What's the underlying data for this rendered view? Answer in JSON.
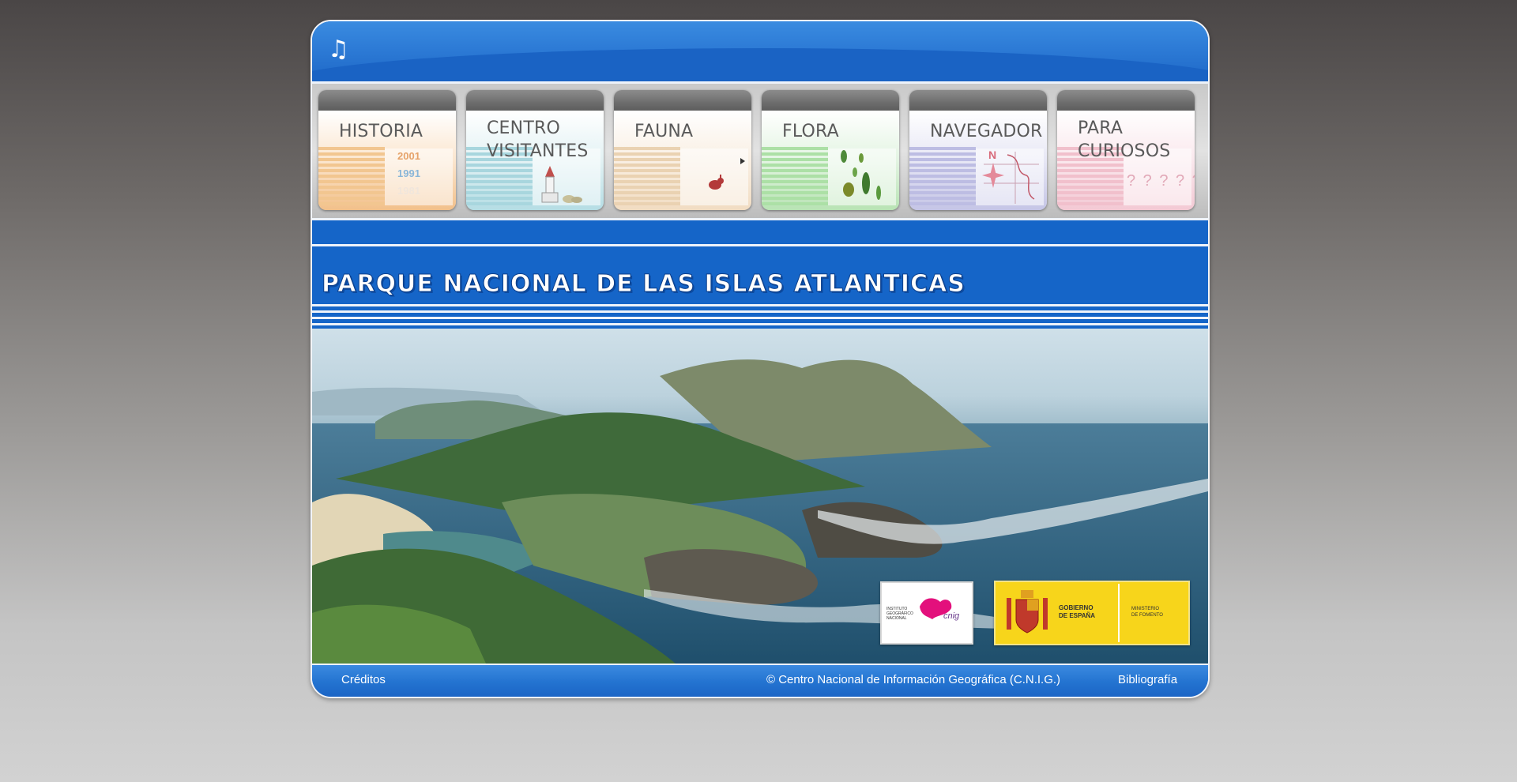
{
  "header": {
    "music_icon": "music-note-icon",
    "music_glyph": "♫"
  },
  "menu": {
    "items": [
      {
        "label": "HISTORIA",
        "decor": [
          "2001",
          "1991",
          "1981"
        ]
      },
      {
        "label": "CENTRO\nVISITANTES"
      },
      {
        "label": "FAUNA"
      },
      {
        "label": "FLORA"
      },
      {
        "label": "NAVEGADOR",
        "decor": [
          "N"
        ]
      },
      {
        "label": "PARA\nCURIOSOS",
        "decor": [
          "? ? ? ? ? ?"
        ]
      }
    ]
  },
  "banner": {
    "title": "PARQUE NACIONAL DE LAS ISLAS ATLANTICAS"
  },
  "logos": {
    "ign_text": "INSTITUTO GEOGRÁFICO NACIONAL",
    "cnig": "cnig",
    "gobierno": "GOBIERNO\nDE ESPAÑA",
    "ministerio": "MINISTERIO\nDE FOMENTO"
  },
  "footer": {
    "credits": "Créditos",
    "copyright": "© Centro Nacional de Información Geográfica (C.N.I.G.)",
    "bibliography": "Bibliografía"
  },
  "colors": {
    "brand_blue": "#1565c8",
    "gov_yellow": "#f7d51b"
  }
}
